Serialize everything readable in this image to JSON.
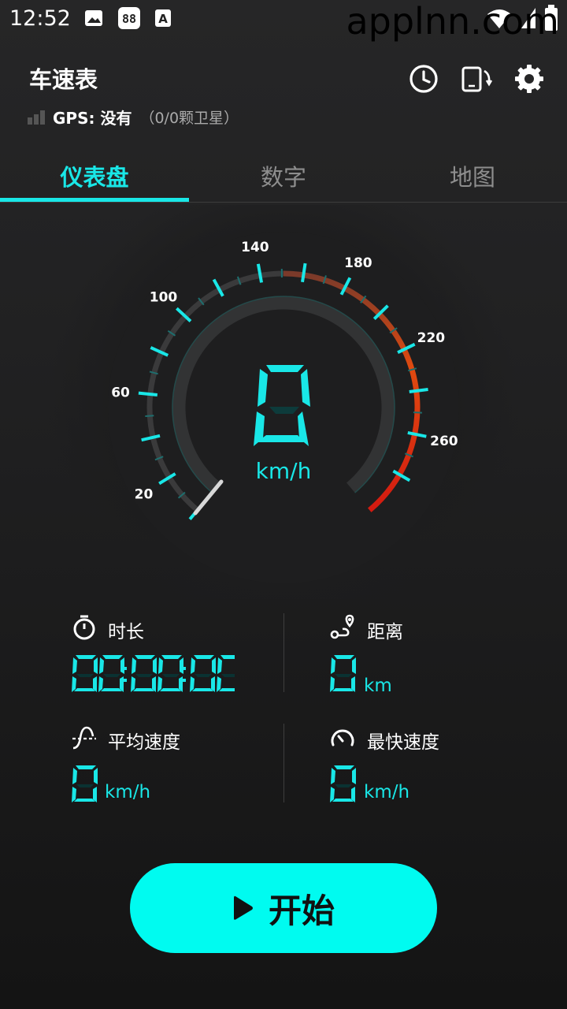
{
  "status_bar": {
    "time": "12:52",
    "watermark": "applnn.com"
  },
  "header": {
    "title": "车速表",
    "gps_label": "GPS: 没有",
    "satellites": "（0/0颗卫星）"
  },
  "tabs": [
    {
      "label": "仪表盘",
      "active": true
    },
    {
      "label": "数字",
      "active": false
    },
    {
      "label": "地图",
      "active": false
    }
  ],
  "gauge": {
    "speed": "0",
    "unit": "km/h",
    "tick_labels": [
      "20",
      "60",
      "100",
      "140",
      "180",
      "220",
      "260"
    ]
  },
  "stats": {
    "duration": {
      "label": "时长",
      "value": "00:00:00"
    },
    "distance": {
      "label": "距离",
      "value": "0",
      "unit": "km"
    },
    "avg_speed": {
      "label": "平均速度",
      "value": "0",
      "unit": "km/h"
    },
    "max_speed": {
      "label": "最快速度",
      "value": "0",
      "unit": "km/h"
    }
  },
  "start_button": {
    "label": "开始"
  },
  "colors": {
    "accent": "#19e7e7",
    "button": "#00fbf0",
    "background": "#222223"
  }
}
